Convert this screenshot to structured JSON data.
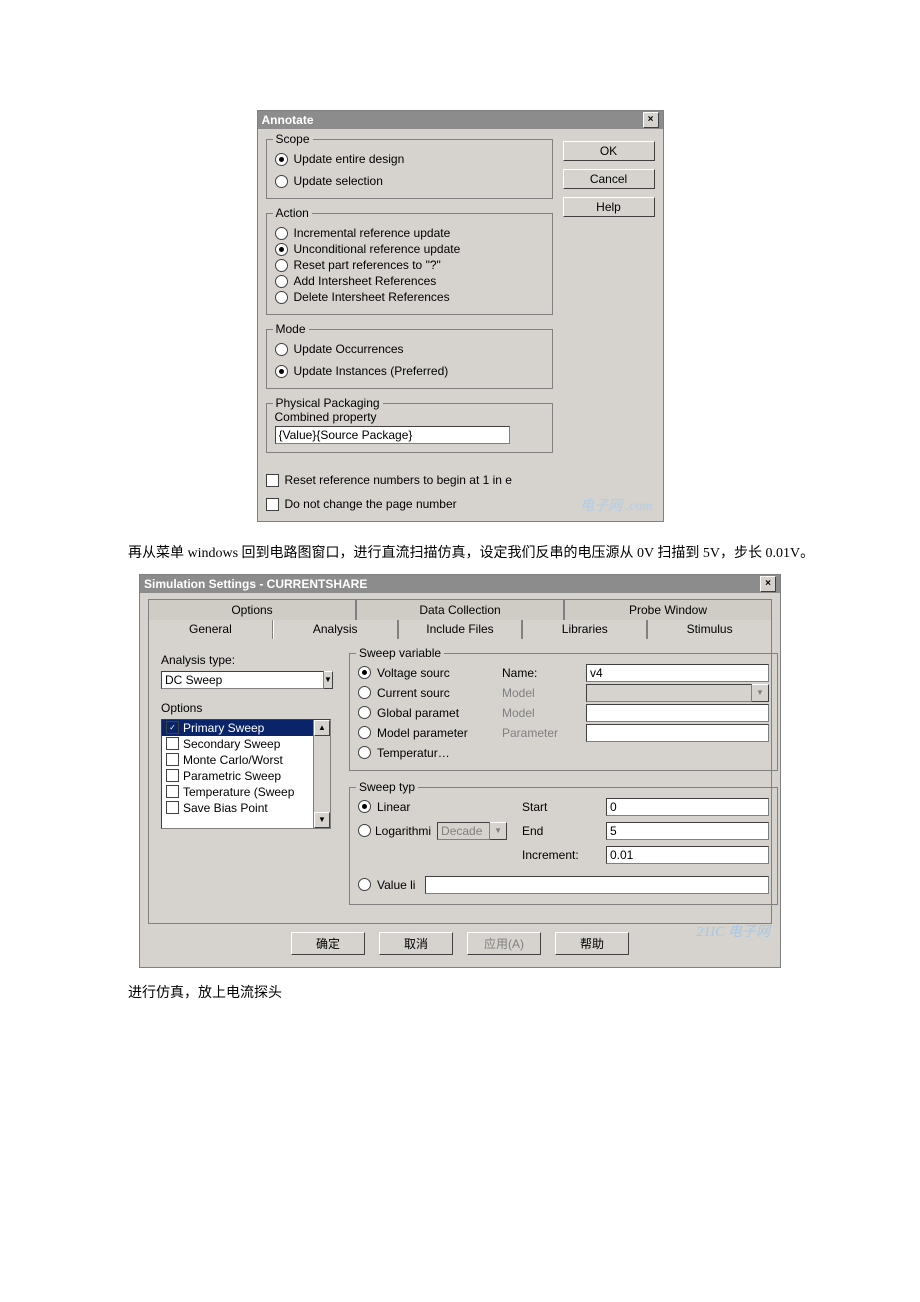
{
  "annotate": {
    "title": "Annotate",
    "close_x": "×",
    "scope": {
      "legend": "Scope",
      "opt_entire": "Update entire design",
      "opt_selection": "Update selection"
    },
    "action": {
      "legend": "Action",
      "opt_incremental": "Incremental reference update",
      "opt_unconditional": "Unconditional reference update",
      "opt_reset": "Reset part references to \"?\"",
      "opt_add_intersheet": "Add Intersheet References",
      "opt_del_intersheet": "Delete Intersheet References"
    },
    "mode": {
      "legend": "Mode",
      "opt_occurrences": "Update Occurrences",
      "opt_instances": "Update Instances (Preferred)"
    },
    "packaging": {
      "legend": "Physical Packaging",
      "combined_label": "Combined property",
      "combined_value": "{Value}{Source Package}"
    },
    "chk_reset_numbers": "Reset reference numbers to begin at 1 in e",
    "chk_keep_page": "Do not change the page number",
    "btn_ok": "OK",
    "btn_cancel": "Cancel",
    "btn_help": "Help",
    "watermark": "电子网 .com"
  },
  "paragraph1": "再从菜单 windows 回到电路图窗口，进行直流扫描仿真，设定我们反串的电压源从 0V 扫描到 5V，步长 0.01V。",
  "simset": {
    "title": "Simulation Settings - CURRENTSHARE",
    "close_x": "×",
    "tabs_back": {
      "options": "Options",
      "data": "Data Collection",
      "probe": "Probe Window"
    },
    "tabs_front": {
      "general": "General",
      "analysis": "Analysis",
      "include": "Include Files",
      "libraries": "Libraries",
      "stimulus": "Stimulus"
    },
    "left": {
      "analysis_type_label": "Analysis type:",
      "analysis_type_value": "DC Sweep",
      "options_label": "Options",
      "list": {
        "primary": "Primary Sweep",
        "secondary": "Secondary Sweep",
        "monte": "Monte Carlo/Worst",
        "parametric": "Parametric Sweep",
        "temperature": "Temperature (Sweep",
        "savebias": "Save Bias Point"
      }
    },
    "sweep_var": {
      "legend": "Sweep variable",
      "opt_voltage": "Voltage sourc",
      "opt_current": "Current sourc",
      "opt_global": "Global paramet",
      "opt_model": "Model parameter",
      "opt_temp": "Temperatur…",
      "name_label": "Name:",
      "name_value": "v4",
      "model_label1": "Model",
      "model_label2": "Model",
      "param_label": "Parameter"
    },
    "sweep_type": {
      "legend": "Sweep typ",
      "opt_linear": "Linear",
      "opt_log": "Logarithmi",
      "log_combo": "Decade",
      "opt_valuelist": "Value li",
      "start_label": "Start",
      "start_value": "0",
      "end_label": "End",
      "end_value": "5",
      "inc_label": "Increment:",
      "inc_value": "0.01"
    },
    "btn_ok": "确定",
    "btn_cancel": "取消",
    "btn_apply": "应用(A)",
    "btn_help": "帮助",
    "watermark": "21IC 电子网"
  },
  "paragraph2": "进行仿真，放上电流探头"
}
